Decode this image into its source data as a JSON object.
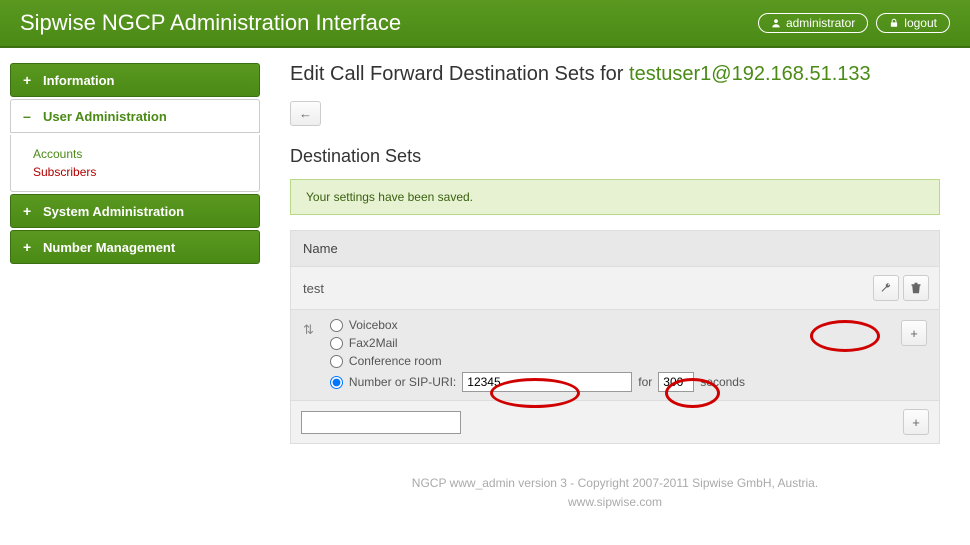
{
  "header": {
    "title": "Sipwise NGCP Administration Interface",
    "user_label": "administrator",
    "logout_label": "logout"
  },
  "sidebar": {
    "items": [
      {
        "label": "Information"
      },
      {
        "label": "User Administration"
      },
      {
        "label": "System Administration"
      },
      {
        "label": "Number Management"
      }
    ],
    "submenu": {
      "accounts": "Accounts",
      "subscribers": "Subscribers"
    }
  },
  "page": {
    "title_prefix": "Edit Call Forward Destination Sets for ",
    "user": "testuser1@192.168.51.133",
    "section_title": "Destination Sets"
  },
  "flash": "Your settings have been saved.",
  "table": {
    "header_name": "Name",
    "set_name": "test",
    "options": {
      "voicebox": "Voicebox",
      "fax2mail": "Fax2Mail",
      "conference": "Conference room",
      "sip_uri_label": "Number or SIP-URI:",
      "sip_uri_value": "12345",
      "for_label": "for",
      "duration_value": "300",
      "seconds_label": "seconds"
    },
    "new_set_value": ""
  },
  "footer": {
    "line1": "NGCP www_admin version 3 - Copyright 2007-2011 Sipwise GmbH, Austria.",
    "line2": "www.sipwise.com"
  }
}
